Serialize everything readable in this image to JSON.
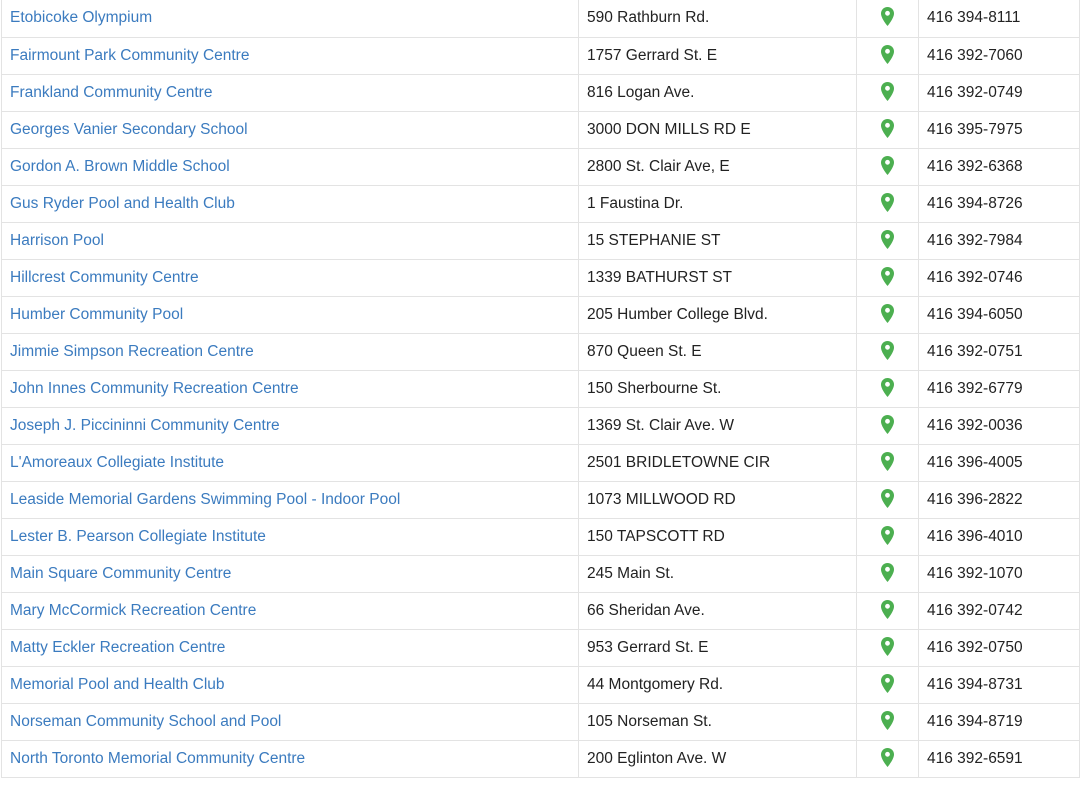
{
  "accent_color": "#3b7bbf",
  "pin_color": "#4caf50",
  "pin_icon": "map-pin-icon",
  "locations": [
    {
      "name": "Etobicoke Olympium",
      "address": "590 Rathburn Rd.",
      "phone": "416 394-8111"
    },
    {
      "name": "Fairmount Park Community Centre",
      "address": "1757 Gerrard St. E",
      "phone": "416 392-7060"
    },
    {
      "name": "Frankland Community Centre",
      "address": "816 Logan Ave.",
      "phone": "416 392-0749"
    },
    {
      "name": "Georges Vanier Secondary School",
      "address": "3000 DON MILLS RD E",
      "phone": "416 395-7975"
    },
    {
      "name": "Gordon A. Brown Middle School",
      "address": "2800 St. Clair Ave, E",
      "phone": "416 392-6368"
    },
    {
      "name": "Gus Ryder Pool and Health Club",
      "address": "1 Faustina Dr.",
      "phone": "416 394-8726"
    },
    {
      "name": "Harrison Pool",
      "address": "15 STEPHANIE ST",
      "phone": "416 392-7984"
    },
    {
      "name": "Hillcrest Community Centre",
      "address": "1339 BATHURST ST",
      "phone": "416 392-0746"
    },
    {
      "name": "Humber Community Pool",
      "address": "205 Humber College Blvd.",
      "phone": "416 394-6050"
    },
    {
      "name": "Jimmie Simpson Recreation Centre",
      "address": "870 Queen St. E",
      "phone": "416 392-0751"
    },
    {
      "name": "John Innes Community Recreation Centre",
      "address": "150 Sherbourne St.",
      "phone": "416 392-6779"
    },
    {
      "name": "Joseph J. Piccininni Community Centre",
      "address": "1369 St. Clair Ave. W",
      "phone": "416 392-0036"
    },
    {
      "name": "L'Amoreaux Collegiate Institute",
      "address": "2501 BRIDLETOWNE CIR",
      "phone": "416 396-4005"
    },
    {
      "name": "Leaside Memorial Gardens Swimming Pool - Indoor Pool",
      "address": "1073 MILLWOOD RD",
      "phone": "416 396-2822"
    },
    {
      "name": "Lester B. Pearson Collegiate Institute",
      "address": "150 TAPSCOTT RD",
      "phone": "416 396-4010"
    },
    {
      "name": "Main Square Community Centre",
      "address": "245 Main St.",
      "phone": "416 392-1070"
    },
    {
      "name": "Mary McCormick Recreation Centre",
      "address": "66 Sheridan Ave.",
      "phone": "416 392-0742"
    },
    {
      "name": "Matty Eckler Recreation Centre",
      "address": "953 Gerrard St. E",
      "phone": "416 392-0750"
    },
    {
      "name": "Memorial Pool and Health Club",
      "address": "44 Montgomery Rd.",
      "phone": "416 394-8731"
    },
    {
      "name": "Norseman Community School and Pool",
      "address": "105 Norseman St.",
      "phone": "416 394-8719"
    },
    {
      "name": "North Toronto Memorial Community Centre",
      "address": "200 Eglinton Ave. W",
      "phone": "416 392-6591"
    }
  ]
}
